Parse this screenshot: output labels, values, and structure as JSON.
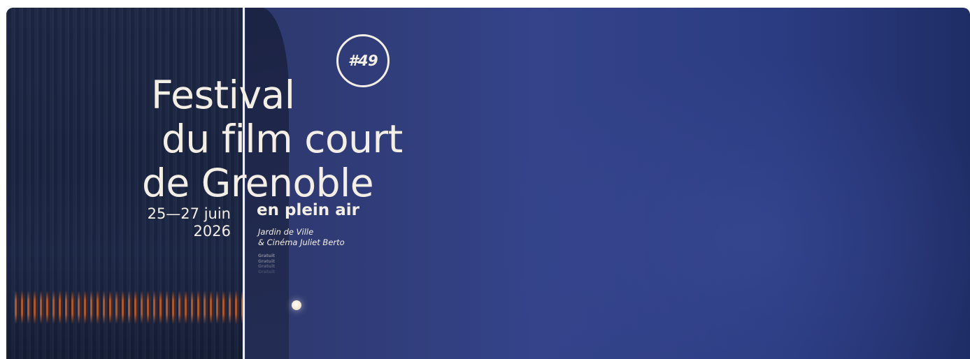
{
  "banner": {
    "edition": "#49",
    "title_lines": [
      "Festival",
      "du film court",
      "de Grenoble"
    ],
    "dates": [
      "25—27 juin",
      "2026"
    ],
    "subtitle": "en plein air",
    "venues": [
      "Jardin de Ville",
      "& Cinéma Juliet Berto"
    ],
    "gratuit": [
      "Gratuit",
      "Gratuit",
      "Gratuit",
      "Gratuit"
    ]
  },
  "colors": {
    "text": "#f4efe6",
    "sky": "#34438a",
    "accent_lights": "#e66e28"
  }
}
